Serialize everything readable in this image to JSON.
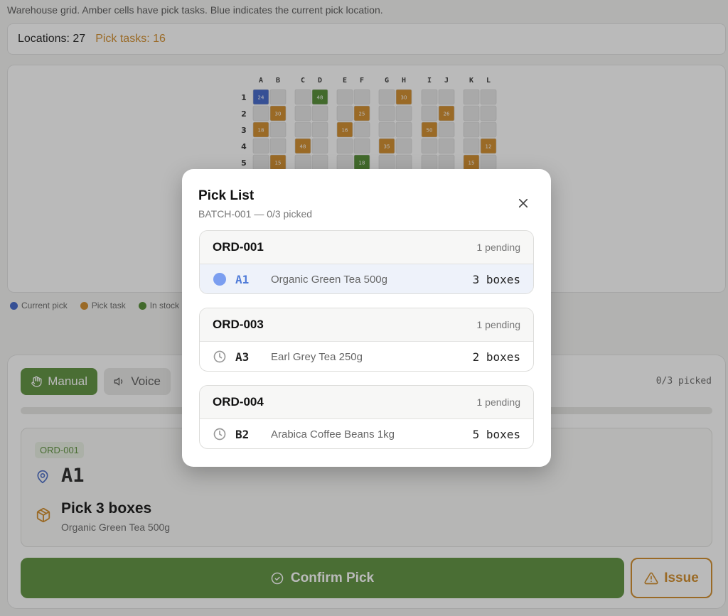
{
  "instructions": "Warehouse grid. Amber cells have pick tasks. Blue indicates the current pick location.",
  "stats": {
    "locations": "Locations: 27",
    "pick_tasks": "Pick tasks: 16"
  },
  "grid": {
    "columns": [
      "A",
      "B",
      "C",
      "D",
      "E",
      "F",
      "G",
      "H",
      "I",
      "J",
      "K",
      "L"
    ],
    "rows": [
      "1",
      "2",
      "3",
      "4",
      "5"
    ],
    "cells": [
      {
        "col": "A",
        "row": "1",
        "status": "current",
        "label": "24"
      },
      {
        "col": "D",
        "row": "1",
        "status": "stock",
        "label": "48"
      },
      {
        "col": "H",
        "row": "1",
        "status": "task",
        "label": "30"
      },
      {
        "col": "B",
        "row": "2",
        "status": "task",
        "label": "30"
      },
      {
        "col": "F",
        "row": "2",
        "status": "task",
        "label": "25"
      },
      {
        "col": "J",
        "row": "2",
        "status": "task",
        "label": "26"
      },
      {
        "col": "A",
        "row": "3",
        "status": "task",
        "label": "18"
      },
      {
        "col": "E",
        "row": "3",
        "status": "task",
        "label": "16"
      },
      {
        "col": "I",
        "row": "3",
        "status": "task",
        "label": "50"
      },
      {
        "col": "C",
        "row": "4",
        "status": "task",
        "label": "48"
      },
      {
        "col": "G",
        "row": "4",
        "status": "task",
        "label": "35"
      },
      {
        "col": "L",
        "row": "4",
        "status": "task",
        "label": "12"
      },
      {
        "col": "B",
        "row": "5",
        "status": "task",
        "label": "15"
      },
      {
        "col": "F",
        "row": "5",
        "status": "stock",
        "label": "18"
      },
      {
        "col": "K",
        "row": "5",
        "status": "task",
        "label": "15"
      }
    ]
  },
  "legend": [
    {
      "label": "Current pick",
      "color": "#3d63c9"
    },
    {
      "label": "Pick task",
      "color": "#d08a26"
    },
    {
      "label": "In stock",
      "color": "#4f8a2e"
    }
  ],
  "controls": {
    "manual_label": "Manual",
    "voice_label": "Voice",
    "picked_count": "0/3 picked",
    "progress": 0
  },
  "current": {
    "order_chip": "ORD-001",
    "location": "A1",
    "instruction": "Pick 3 boxes",
    "product": "Organic Green Tea 500g"
  },
  "actions": {
    "confirm_label": "Confirm Pick",
    "issue_label": "Issue"
  },
  "modal": {
    "title": "Pick List",
    "subtitle": "BATCH-001 — 0/3 picked",
    "orders": [
      {
        "id": "ORD-001",
        "pending": "1 pending",
        "location": "A1",
        "product": "Organic Green Tea 500g",
        "qty": "3 boxes",
        "status": "current"
      },
      {
        "id": "ORD-003",
        "pending": "1 pending",
        "location": "A3",
        "product": "Earl Grey Tea 250g",
        "qty": "2 boxes",
        "status": "waiting"
      },
      {
        "id": "ORD-004",
        "pending": "1 pending",
        "location": "B2",
        "product": "Arabica Coffee Beans 1kg",
        "qty": "5 boxes",
        "status": "waiting"
      }
    ]
  },
  "colors": {
    "current": "#3d63c9",
    "task": "#d08a26",
    "stock": "#4f8a2e",
    "empty": "#e6e6e6",
    "accent_green": "#5a8f3a"
  }
}
